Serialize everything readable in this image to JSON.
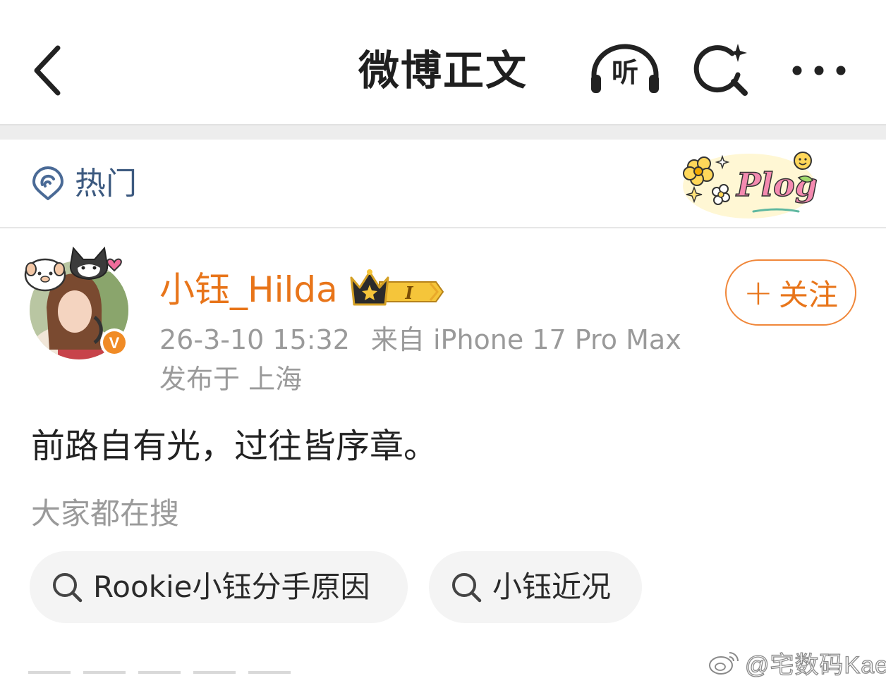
{
  "nav": {
    "title": "微博正文",
    "listen_label": "听",
    "icons": [
      "back-arrow-icon",
      "headphones-icon",
      "search-sparkle-icon",
      "more-dots-icon"
    ]
  },
  "hot": {
    "label": "热门",
    "icon": "hot-signal-icon",
    "sticker_text": "Plog"
  },
  "post": {
    "username": "小钰_Hilda",
    "vip_level": "I",
    "verified_badge": "V",
    "follow_label": "关注",
    "follow_plus": "+",
    "time": "26-3-10 15:32",
    "source": "来自 iPhone 17 Pro Max",
    "location": "发布于 上海",
    "text": "前路自有光，过往皆序章。"
  },
  "search": {
    "title": "大家都在搜",
    "chips": [
      {
        "label": "Rookie小钰分手原因"
      },
      {
        "label": "小钰近况"
      }
    ]
  },
  "watermark": {
    "text": "@宅数码Kael"
  },
  "colors": {
    "accent_orange": "#e8751a",
    "link_blue": "#3d5a80",
    "meta_gray": "#9a9a9a",
    "chip_bg": "#f4f4f4"
  }
}
